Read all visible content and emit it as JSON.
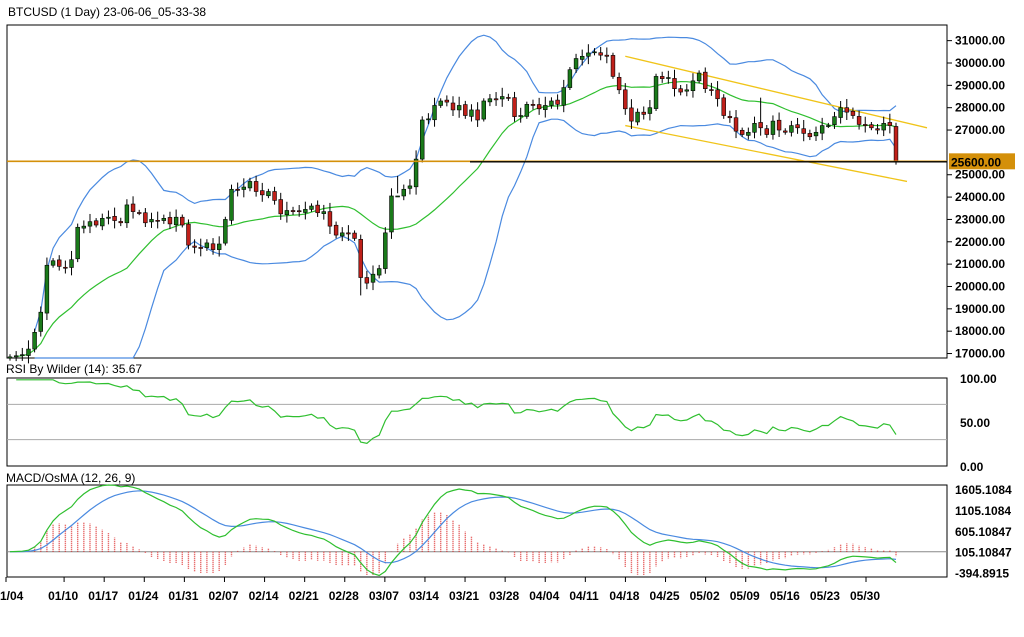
{
  "header": {
    "title": "BTCUSD (1 Day) 23-06-06_05-33-38"
  },
  "colors": {
    "up": "#1a7a1a",
    "down": "#c0201a",
    "bb": "#4a8ae0",
    "mid": "#2fbf2f",
    "channel": "#f0c419",
    "support": "#d4900a",
    "macd": "#2fbf2f",
    "signal": "#4a8ae0",
    "osma": "#e04040"
  },
  "chart_data": [
    {
      "type": "candlestick",
      "title": "BTCUSD (1 Day) 23-06-06_05-33-38",
      "x_tick_labels": [
        "1/04",
        "01/10",
        "01/17",
        "01/24",
        "01/31",
        "02/07",
        "02/14",
        "02/21",
        "02/28",
        "03/07",
        "03/14",
        "03/21",
        "03/28",
        "04/04",
        "04/11",
        "04/18",
        "04/25",
        "05/02",
        "05/09",
        "05/16",
        "05/23",
        "05/30"
      ],
      "y_tick_labels": [
        "31000.00",
        "30000.00",
        "29000.00",
        "28000.00",
        "27000.00",
        "26000.00",
        "25000.00",
        "24000.00",
        "23000.00",
        "22000.00",
        "21000.00",
        "20000.00",
        "19000.00",
        "18000.00",
        "17000.00"
      ],
      "ylim": [
        16800,
        31700
      ],
      "horizontal_line": {
        "value": 25600,
        "label": "25600.00"
      },
      "close": [
        16850,
        16900,
        16950,
        17200,
        17950,
        18850,
        20950,
        21150,
        20900,
        20850,
        21200,
        22650,
        22700,
        22900,
        22750,
        23050,
        23100,
        22950,
        22850,
        23650,
        23350,
        23300,
        22850,
        23000,
        22950,
        23050,
        22800,
        23100,
        22750,
        21850,
        21750,
        21700,
        21950,
        21650,
        21900,
        23000,
        24350,
        24300,
        24450,
        24700,
        24250,
        24100,
        24250,
        23850,
        23250,
        23400,
        23350,
        23350,
        23450,
        23600,
        23300,
        23350,
        22700,
        22300,
        22400,
        22350,
        22150,
        20400,
        20150,
        20550,
        20800,
        22400,
        24050,
        24050,
        24350,
        24500,
        25700,
        27450,
        27500,
        28100,
        28300,
        28250,
        27900,
        28100,
        27650,
        27900,
        27450,
        28300,
        28400,
        28350,
        28500,
        28450,
        27600,
        27650,
        28150,
        28100,
        27950,
        28100,
        28300,
        28150,
        28900,
        29700,
        30200,
        30300,
        30450,
        30500,
        30350,
        30300,
        29400,
        28800,
        27950,
        27400,
        27800,
        27700,
        28000,
        29400,
        29300,
        29350,
        28850,
        28700,
        28800,
        29200,
        29550,
        28850,
        28800,
        28400,
        27650,
        27550,
        26950,
        26800,
        26900,
        27300,
        27100,
        26800,
        27400,
        27000,
        26900,
        27200,
        27100,
        26850,
        26700,
        26900,
        27200,
        27200,
        27600,
        28000,
        27800,
        27650,
        27250,
        27200,
        27100,
        27000,
        27300,
        27200,
        25600
      ],
      "dates_range": [
        "2023-01-04",
        "2023-06-05"
      ],
      "bollinger_bands": {
        "period": 20
      }
    },
    {
      "type": "line",
      "title": "RSI By Wilder (14): 35.67",
      "y_tick_labels": [
        "100.00",
        "50.00",
        "0.00"
      ],
      "ylim": [
        0,
        100
      ],
      "levels": [
        70,
        30
      ],
      "series": [
        {
          "name": "RSI By Wilder (14)",
          "last": 35.67
        }
      ]
    },
    {
      "type": "line",
      "title": "MACD/OsMA (12, 26, 9)",
      "y_tick_labels": [
        "1605.1084",
        "1105.1084",
        "605.10847",
        "105.10847",
        "-394.8915"
      ],
      "ylim": [
        -500,
        1700
      ],
      "series": [
        {
          "name": "MACD"
        },
        {
          "name": "Signal"
        },
        {
          "name": "OsMA"
        }
      ]
    }
  ]
}
